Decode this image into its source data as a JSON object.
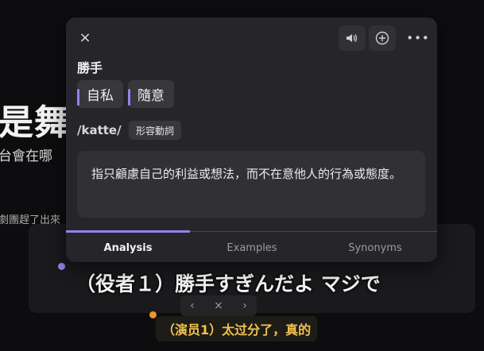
{
  "background": {
    "title": "是舞",
    "subtitle": "台會在哪",
    "line": "劇團趕了出來"
  },
  "captions": {
    "japanese": "（役者１）勝手すぎんだよ マジで",
    "chinese": "（演员1）太过分了，真的",
    "nav": {
      "prev": "‹",
      "close": "×",
      "next": "›"
    }
  },
  "popup": {
    "icons": {
      "close": "×",
      "speaker": "speaker-icon",
      "add": "plus-circle-icon",
      "more": "•••"
    },
    "word": "勝手",
    "senses": [
      "自私",
      "隨意"
    ],
    "reading": "/katte/",
    "part_of_speech": "形容動詞",
    "definition": "指只顧慮自己的利益或想法，而不在意他人的行為或態度。",
    "tabs": [
      "Analysis",
      "Examples",
      "Synonyms"
    ],
    "active_tab": "Analysis"
  },
  "colors": {
    "accent": "#9b7ff0",
    "subtitle_zh": "#f2c24e",
    "dot_orange": "#f0932b"
  }
}
